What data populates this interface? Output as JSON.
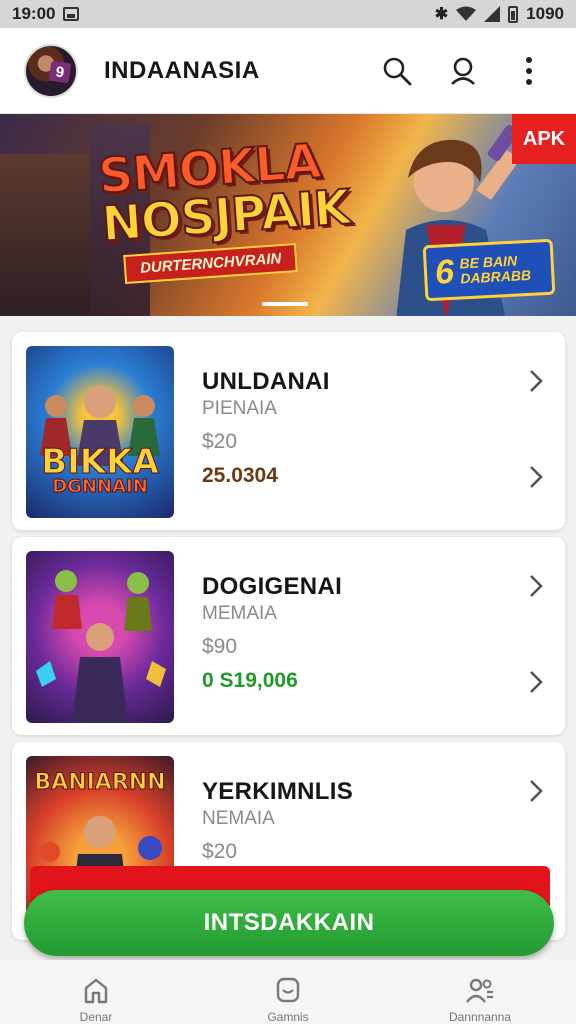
{
  "status_bar": {
    "time": "19:00",
    "battery_text": "1090",
    "icons": [
      "image-icon",
      "bluetooth-icon",
      "wifi-icon",
      "signal-icon",
      "battery-icon"
    ]
  },
  "app_bar": {
    "title": "INDAANASIA",
    "avatar_badge": "9",
    "actions": [
      "search-icon",
      "account-search-icon",
      "more-vert-icon"
    ]
  },
  "banner": {
    "title_line1": "SMOKLA",
    "title_line2": "NOSJPAIK",
    "ribbon": "DURTERNCHVRAIN",
    "apk_tag": "APK",
    "promo_number": "6",
    "promo_line1": "BE BAIN",
    "promo_line2": "DABRABB"
  },
  "games": [
    {
      "name": "UNLDANAI",
      "subtitle": "PIENAIA",
      "price": "$20",
      "count": "25.0304",
      "count_color": "#6b3a12",
      "thumb_text": "BIKKA",
      "thumb_sub": "DGNNAIN"
    },
    {
      "name": "DOGIGENAI",
      "subtitle": "MEMAIA",
      "price": "$90",
      "count": "0 S19,006",
      "count_color": "#1e9a2a",
      "thumb_text": "",
      "thumb_sub": ""
    },
    {
      "name": "YERKIMNLIS",
      "subtitle": "NEMAIA",
      "price": "$20",
      "count": "",
      "count_color": "#1a1a1a",
      "thumb_text": "BANIARNN",
      "thumb_sub": ""
    }
  ],
  "install_button": {
    "label": "INTSDAKKAIN"
  },
  "bottom_nav": [
    {
      "icon": "home-icon",
      "label": "Denar"
    },
    {
      "icon": "chat-icon",
      "label": "Gamnis"
    },
    {
      "icon": "people-icon",
      "label": "Dannnanna"
    }
  ],
  "colors": {
    "primary_green": "#249a30",
    "accent_red": "#e0141a",
    "banner_gold": "#ffd23a"
  }
}
